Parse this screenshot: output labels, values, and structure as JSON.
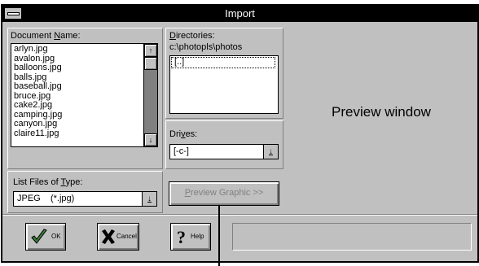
{
  "window": {
    "title": "Import"
  },
  "document_name": {
    "label_pre": "Document ",
    "label_accel": "N",
    "label_post": "ame:",
    "files": [
      "arlyn.jpg",
      "avalon.jpg",
      "balloons.jpg",
      "balls.jpg",
      "baseball.jpg",
      "bruce.jpg",
      "cake2.jpg",
      "camping.jpg",
      "canyon.jpg",
      "claire11.jpg"
    ],
    "scroll_up": "↑",
    "scroll_down": "↓"
  },
  "directories": {
    "label_accel": "D",
    "label_post": "irectories:",
    "path": "c:\\photopls\\photos",
    "items": [
      "[..]"
    ]
  },
  "drives": {
    "label_pre": "Dri",
    "label_accel": "v",
    "label_post": "es:",
    "selected": "[-c-]",
    "dropdown_glyph": "↓"
  },
  "file_type": {
    "label_pre": "List Files of ",
    "label_accel": "T",
    "label_post": "ype:",
    "selected": "JPEG    (*.jpg)",
    "dropdown_glyph": "↓"
  },
  "preview": {
    "button_accel": "P",
    "button_post": "review Graphic >>",
    "window_label": "Preview window"
  },
  "buttons": {
    "ok": "OK",
    "cancel": "Cancel",
    "help": "Help"
  },
  "colors": {
    "face": "#c0c0c0",
    "titlebar": "#000000",
    "ok_check": "#3a7d3a",
    "help_q": "#000000"
  }
}
